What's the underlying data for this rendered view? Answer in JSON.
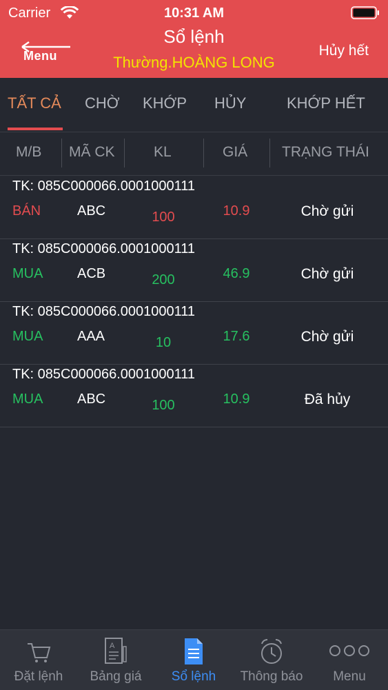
{
  "status_bar": {
    "carrier": "Carrier",
    "time": "10:31 AM"
  },
  "header": {
    "back_label": "Menu",
    "title": "Sổ lệnh",
    "subtitle": "Thường.HOÀNG LONG",
    "cancel_all": "Hủy hết"
  },
  "tabs": [
    {
      "label": "TẤT CẢ",
      "active": true
    },
    {
      "label": "CHỜ"
    },
    {
      "label": "KHỚP"
    },
    {
      "label": "HỦY"
    },
    {
      "label": "KHỚP HẾT"
    }
  ],
  "columns": [
    "M/B",
    "MÃ CK",
    "KL",
    "GIÁ",
    "TRẠNG THÁI"
  ],
  "orders": [
    {
      "account": "TK: 085C000066.0001000111",
      "side": "BÁN",
      "symbol": "ABC",
      "qty": "100",
      "price": "10.9",
      "status": "Chờ gửi"
    },
    {
      "account": "TK: 085C000066.0001000111",
      "side": "MUA",
      "symbol": "ACB",
      "qty": "200",
      "price": "46.9",
      "status": "Chờ gửi"
    },
    {
      "account": "TK: 085C000066.0001000111",
      "side": "MUA",
      "symbol": "AAA",
      "qty": "10",
      "price": "17.6",
      "status": "Chờ gửi"
    },
    {
      "account": "TK: 085C000066.0001000111",
      "side": "MUA",
      "symbol": "ABC",
      "qty": "100",
      "price": "10.9",
      "status": "Đã hủy"
    }
  ],
  "tabbar": [
    {
      "label": "Đặt lệnh",
      "icon": "cart-icon"
    },
    {
      "label": "Bảng giá",
      "icon": "price-board-icon"
    },
    {
      "label": "Sổ lệnh",
      "icon": "order-book-icon",
      "active": true
    },
    {
      "label": "Thông báo",
      "icon": "alarm-clock-icon"
    },
    {
      "label": "Menu",
      "icon": "more-dots-icon"
    }
  ],
  "colors": {
    "header_bg": "#e34c4f",
    "sell": "#e34c4f",
    "buy": "#27c060",
    "active_tab": "#e58a5a",
    "tabbar_active": "#3d8ef5",
    "subtitle": "#f3e500"
  }
}
